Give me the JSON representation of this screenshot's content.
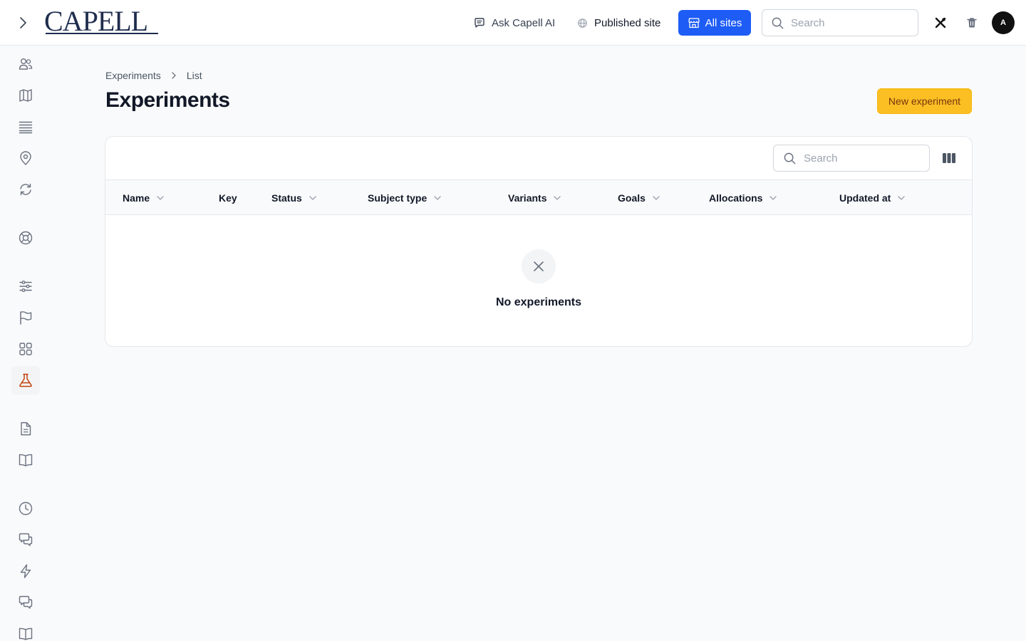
{
  "header": {
    "logo_text": "CAPELL",
    "ask_ai_label": "Ask Capell AI",
    "published_site_label": "Published site",
    "all_sites_label": "All sites",
    "search_placeholder": "Search",
    "avatar_initial": "A"
  },
  "sidebar": {
    "items": [
      {
        "icon": "users-icon"
      },
      {
        "icon": "map-icon"
      },
      {
        "icon": "stack-icon"
      },
      {
        "icon": "map-pin-icon"
      },
      {
        "icon": "sync-icon"
      },
      {
        "icon": "lifebuoy-icon"
      },
      {
        "icon": "sliders-icon"
      },
      {
        "icon": "flag-icon"
      },
      {
        "icon": "grid-icon"
      },
      {
        "icon": "beaker-icon",
        "active": true
      },
      {
        "icon": "document-icon"
      },
      {
        "icon": "book-icon"
      },
      {
        "icon": "clock-icon"
      },
      {
        "icon": "chat-icon"
      },
      {
        "icon": "bolt-icon"
      },
      {
        "icon": "chat-icon"
      },
      {
        "icon": "book-icon"
      }
    ],
    "active_color": "#c2410c"
  },
  "breadcrumb": {
    "items": [
      "Experiments",
      "List"
    ]
  },
  "page": {
    "title": "Experiments",
    "new_button_label": "New experiment"
  },
  "table": {
    "search_placeholder": "Search",
    "columns": [
      {
        "label": "Name",
        "sortable": true
      },
      {
        "label": "Key",
        "sortable": false
      },
      {
        "label": "Status",
        "sortable": true
      },
      {
        "label": "Subject type",
        "sortable": true
      },
      {
        "label": "Variants",
        "sortable": true
      },
      {
        "label": "Goals",
        "sortable": true
      },
      {
        "label": "Allocations",
        "sortable": true
      },
      {
        "label": "Updated at",
        "sortable": true
      }
    ],
    "rows": [],
    "empty_message": "No experiments"
  },
  "colors": {
    "primary": "#1d5cf5",
    "accent": "#fbbf24",
    "accent_text": "#78350f"
  }
}
